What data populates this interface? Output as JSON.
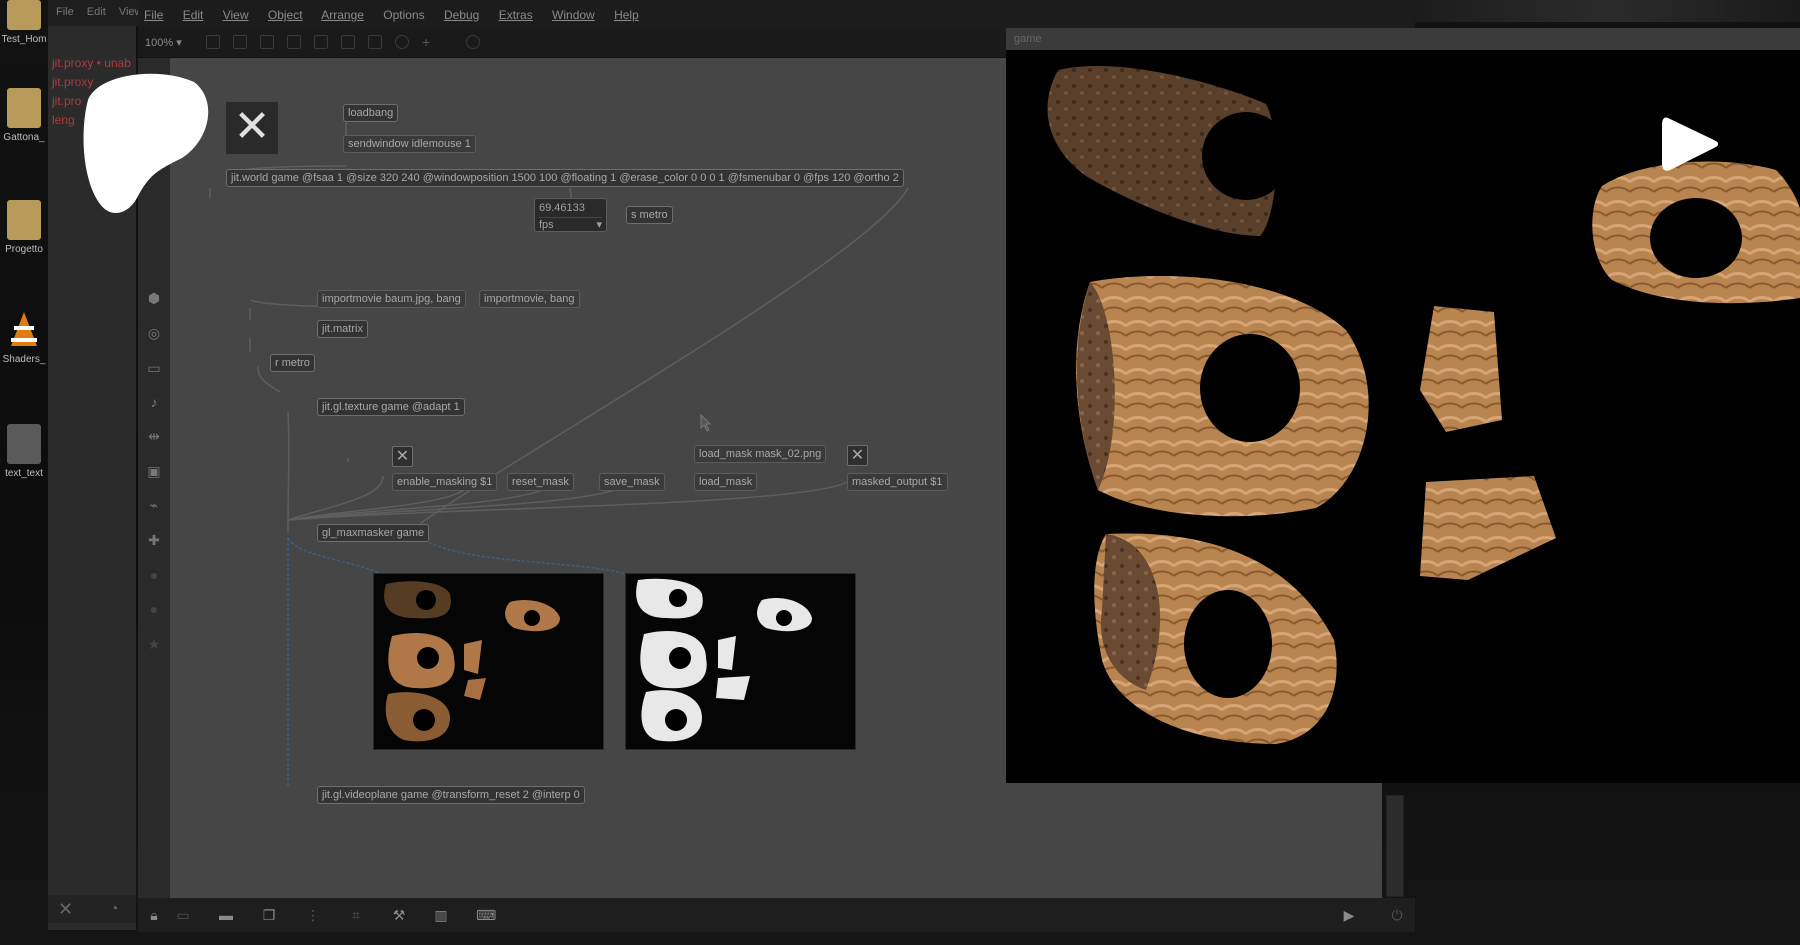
{
  "desktop": {
    "icons": [
      {
        "label": "Test_Hom",
        "icon": "folder-icon",
        "color": "#b89a5a"
      },
      {
        "label": "Gattona_",
        "icon": "folder-icon",
        "color": "#b89a5a"
      },
      {
        "label": "Progetto",
        "icon": "folder-icon",
        "color": "#b89a5a"
      },
      {
        "label": "Shaders_",
        "icon": "vlc-icon",
        "color": "#e07b10"
      },
      {
        "label": "text_text",
        "icon": "file-icon",
        "color": "#9a9a9a"
      }
    ]
  },
  "console": {
    "menu": [
      "File",
      "Edit",
      "View"
    ],
    "lines": [
      "jit.proxy • unab",
      "jit.proxy",
      "jit.pro",
      "leng"
    ]
  },
  "menubar": {
    "items": [
      "File",
      "Edit",
      "View",
      "Object",
      "Arrange",
      "Options",
      "Debug",
      "Extras",
      "Window",
      "Help"
    ]
  },
  "toolbar": {
    "zoom": "100% ▾"
  },
  "patch": {
    "objects": {
      "loadbang": "loadbang",
      "sendwindow": "sendwindow idlemouse 1",
      "jit_world": "jit.world game @fsaa 1 @size 320 240 @windowposition 1500 100 @floating 1 @erase_color 0 0 0 1 @fsmenubar 0 @fps 120 @ortho 2",
      "s_metro": "s metro",
      "importmovie1": "importmovie baum.jpg, bang",
      "importmovie2": "importmovie, bang",
      "jit_matrix": "jit.matrix",
      "r_metro": "r metro",
      "jit_gl_texture": "jit.gl.texture game @adapt 1",
      "load_mask_file": "load_mask mask_02.png",
      "enable_masking": "enable_masking $1",
      "reset_mask": "reset_mask",
      "save_mask": "save_mask",
      "load_mask": "load_mask",
      "masked_output": "masked_output $1",
      "gl_maxmasker": "gl_maxmasker game",
      "jit_gl_videoplane": "jit.gl.videoplane game @transform_reset 2 @interp 0"
    },
    "fps_number": "69.46133",
    "fps_label": "fps"
  },
  "game_window": {
    "title": "game"
  }
}
